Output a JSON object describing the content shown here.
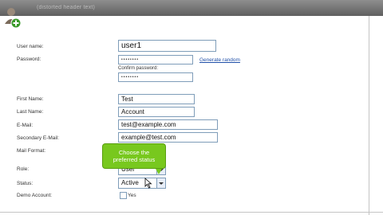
{
  "header": {
    "title": "(distorted header text)"
  },
  "labels": {
    "user_name": "User name:",
    "password": "Password:",
    "confirm_password": "Confirm password:",
    "first_name": "First Name:",
    "last_name": "Last Name:",
    "email": "E-Mail:",
    "secondary_email": "Secondary E-Mail:",
    "mail_format": "Mail Format:",
    "role": "Role:",
    "status": "Status:",
    "demo_account": "Demo Account:"
  },
  "fields": {
    "user_name": "user1",
    "password": "••••••••",
    "confirm_password": "••••••••",
    "first_name": "Test",
    "last_name": "Account",
    "email": "test@example.com",
    "secondary_email": "example@test.com",
    "role": "User",
    "status": "Active"
  },
  "links": {
    "generate_random": "Generate random"
  },
  "tooltip": {
    "line1": "Choose the",
    "line2": "preferred status"
  },
  "demo": {
    "checkbox_label": "Yes",
    "checked": false
  },
  "icons": {
    "user_add": "user-add-icon",
    "cursor": "mouse-cursor-icon"
  }
}
